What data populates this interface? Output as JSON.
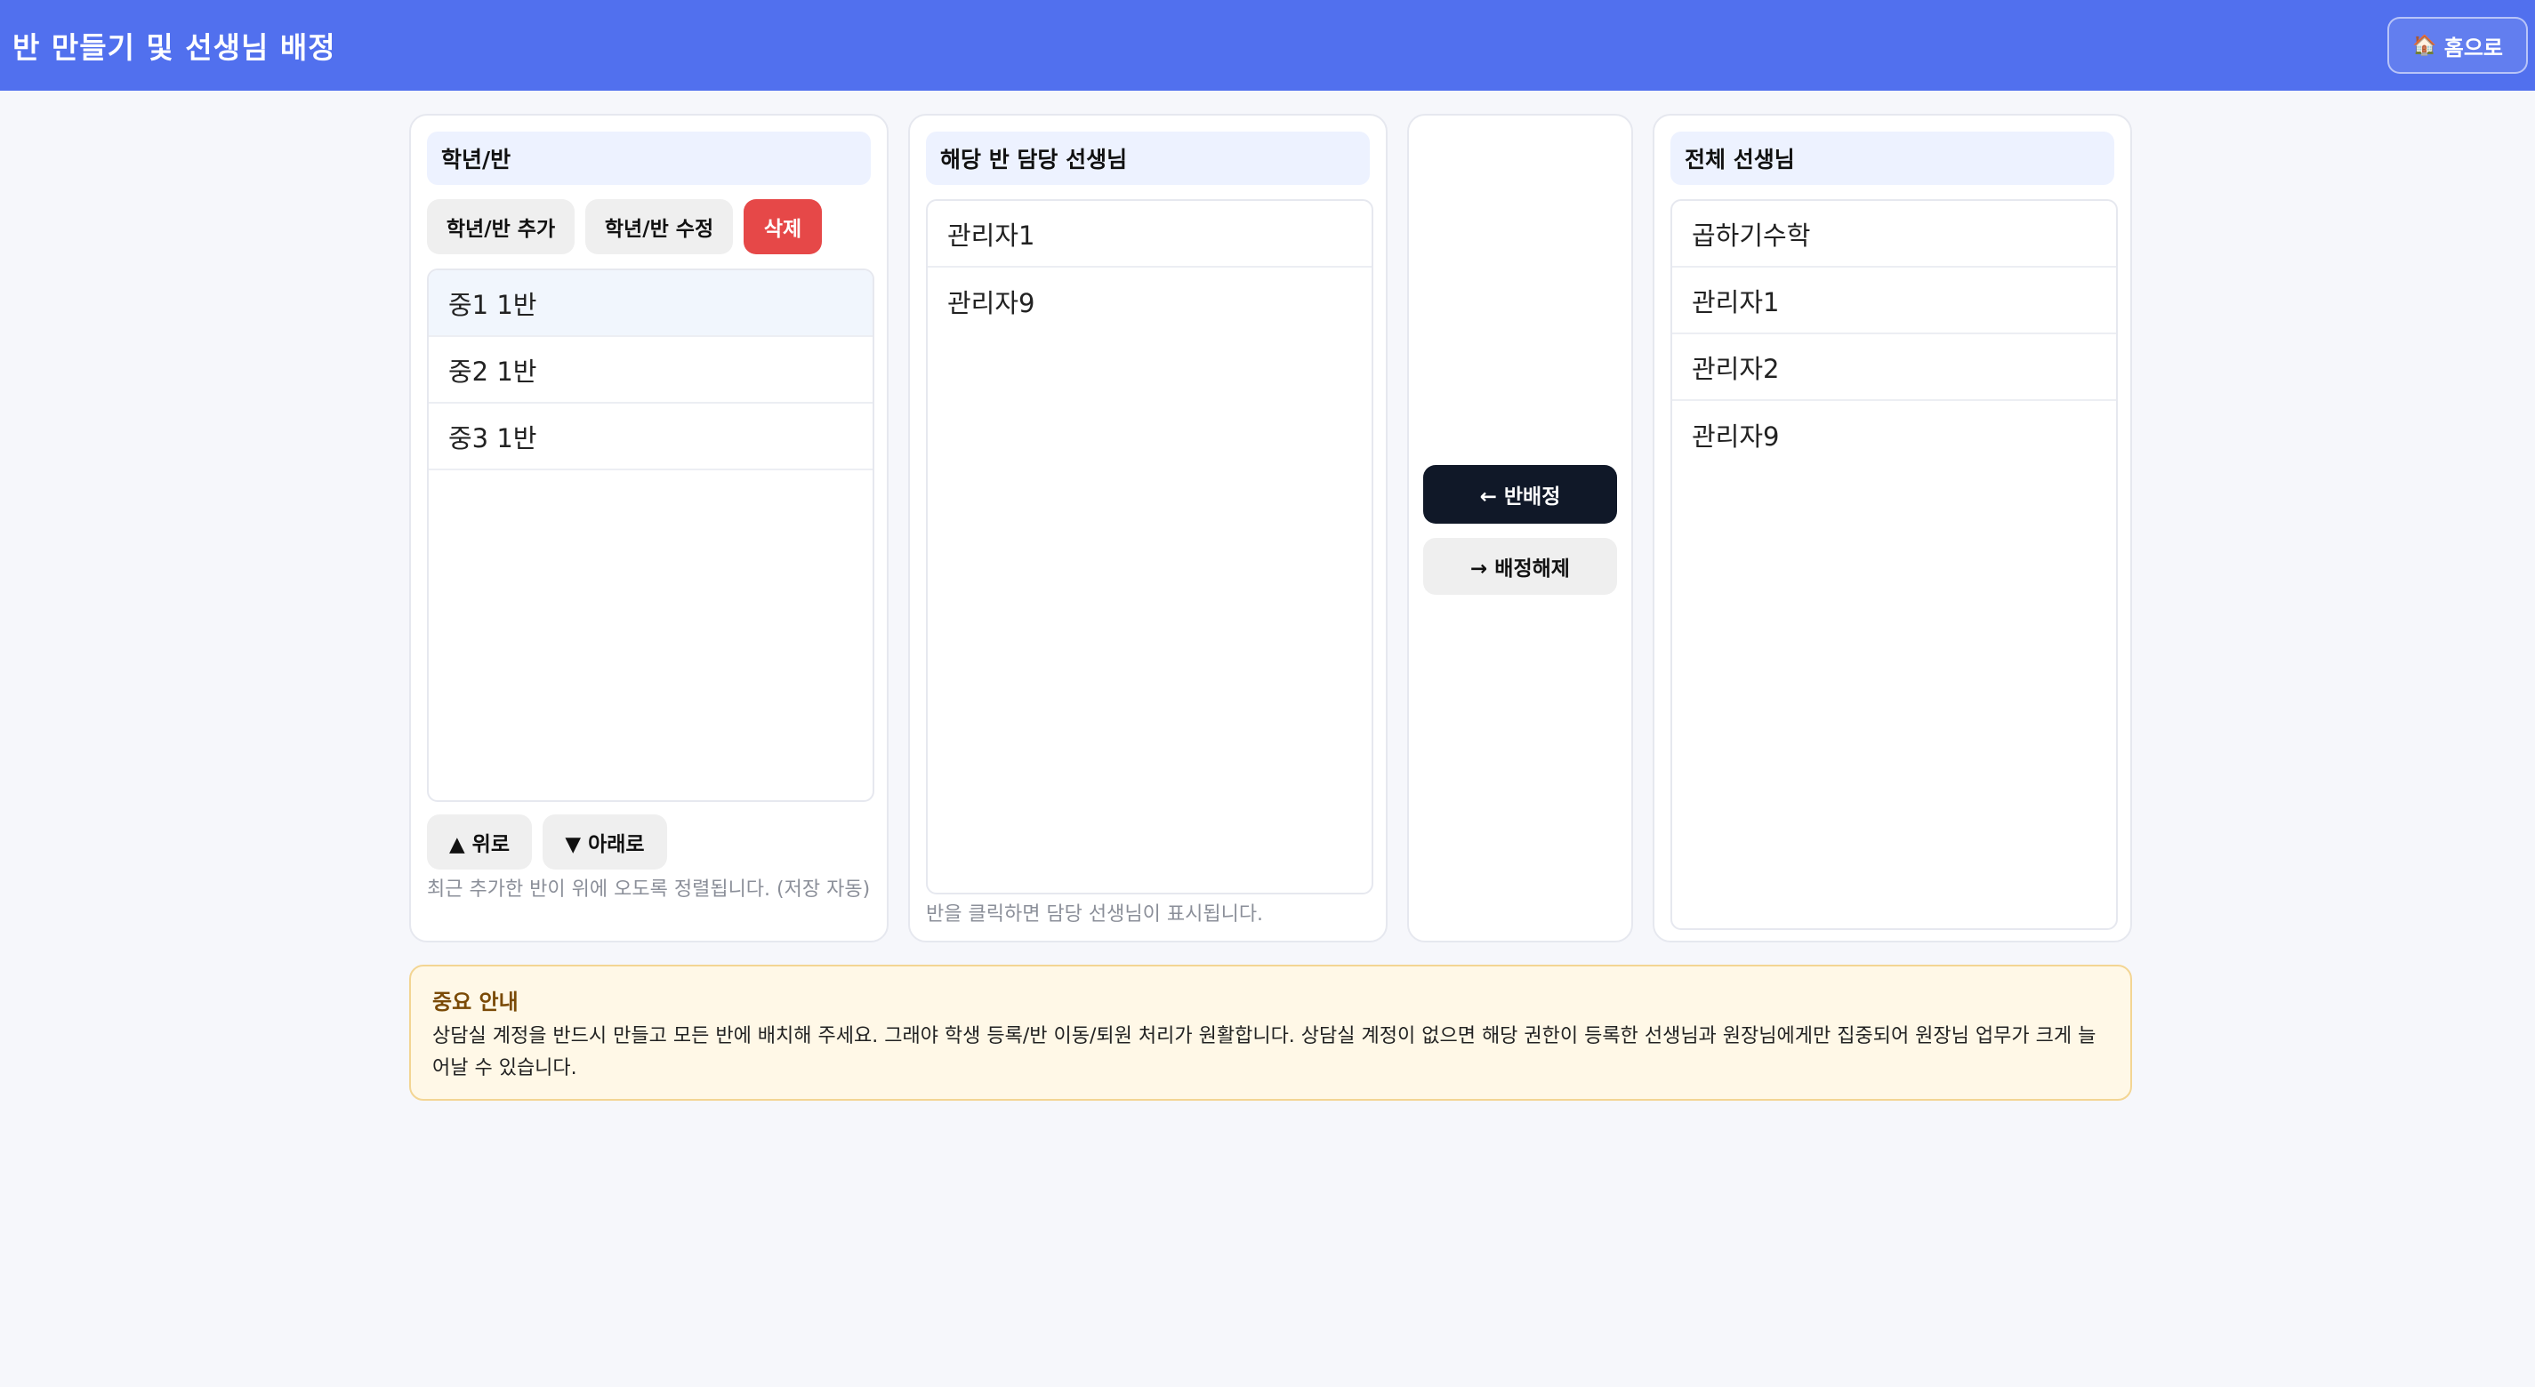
{
  "header": {
    "title": "반 만들기 및 선생님 배정",
    "home_icon": "🏠",
    "home_label": "홈으로"
  },
  "classes_panel": {
    "title": "학년/반",
    "add_label": "학년/반 추가",
    "edit_label": "학년/반 수정",
    "delete_label": "삭제",
    "items": [
      "중1 1반",
      "중2 1반",
      "중3 1반"
    ],
    "selected_index": 0,
    "up_label": "▲ 위로",
    "down_label": "▼ 아래로",
    "hint": "최근 추가한 반이 위에 오도록 정렬됩니다. (저장 자동)"
  },
  "assigned_panel": {
    "title": "해당 반 담당 선생님",
    "items": [
      "관리자1",
      "관리자9"
    ],
    "hint": "반을 클릭하면 담당 선생님이 표시됩니다."
  },
  "actions": {
    "assign_label": "← 반배정",
    "unassign_label": "→ 배정해제"
  },
  "all_teachers_panel": {
    "title": "전체 선생님",
    "items": [
      "곱하기수학",
      "관리자1",
      "관리자2",
      "관리자9"
    ]
  },
  "notice": {
    "title": "중요 안내",
    "body": "상담실 계정을 반드시 만들고 모든 반에 배치해 주세요. 그래야 학생 등록/반 이동/퇴원 처리가 원활합니다. 상담실 계정이 없으면 해당 권한이 등록한 선생님과 원장님에게만 집중되어 원장님 업무가 크게 늘어날 수 있습니다."
  },
  "colors": {
    "header_bg": "#5170ee",
    "delete_bg": "#e64848",
    "assign_bg": "#101828",
    "notice_bg": "#fff8e7"
  }
}
